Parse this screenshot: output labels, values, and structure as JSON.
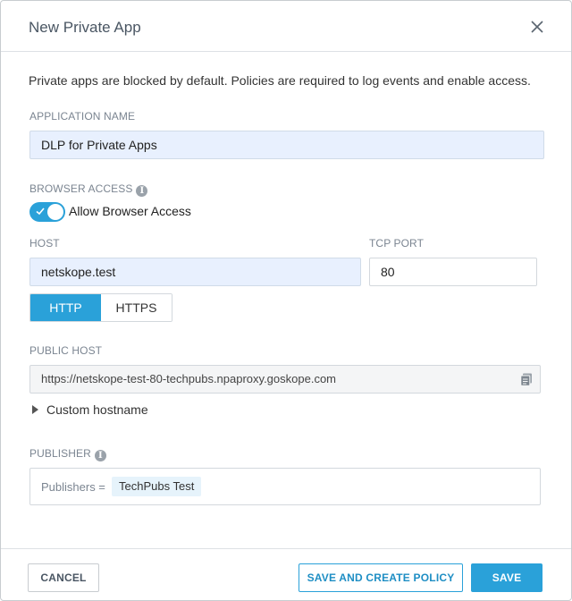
{
  "dialog": {
    "title": "New Private App",
    "close_icon": "close-icon",
    "intro": "Private apps are blocked by default. Policies are required to log events and enable access."
  },
  "application_name": {
    "label": "APPLICATION NAME",
    "value": "DLP for Private Apps"
  },
  "browser_access": {
    "label": "BROWSER ACCESS",
    "info_icon": "info-icon",
    "toggle_label": "Allow Browser Access",
    "enabled": true
  },
  "host": {
    "label": "HOST",
    "value": "netskope.test"
  },
  "tcp_port": {
    "label": "TCP PORT",
    "value": "80"
  },
  "protocol": {
    "options": [
      "HTTP",
      "HTTPS"
    ],
    "selected": "HTTP"
  },
  "public_host": {
    "label": "PUBLIC HOST",
    "value": "https://netskope-test-80-techpubs.npaproxy.goskope.com",
    "copy_icon": "copy-icon"
  },
  "custom_hostname": {
    "label": "Custom hostname"
  },
  "publisher": {
    "label": "PUBLISHER",
    "info_icon": "info-icon",
    "key": "Publishers =",
    "tag": "TechPubs Test"
  },
  "footer": {
    "cancel_label": "CANCEL",
    "save_policy_label": "SAVE AND CREATE POLICY",
    "save_label": "SAVE"
  },
  "colors": {
    "accent": "#2aa1d9",
    "filled_input": "#e8f0fe",
    "tag_bg": "#e6f3fb"
  }
}
